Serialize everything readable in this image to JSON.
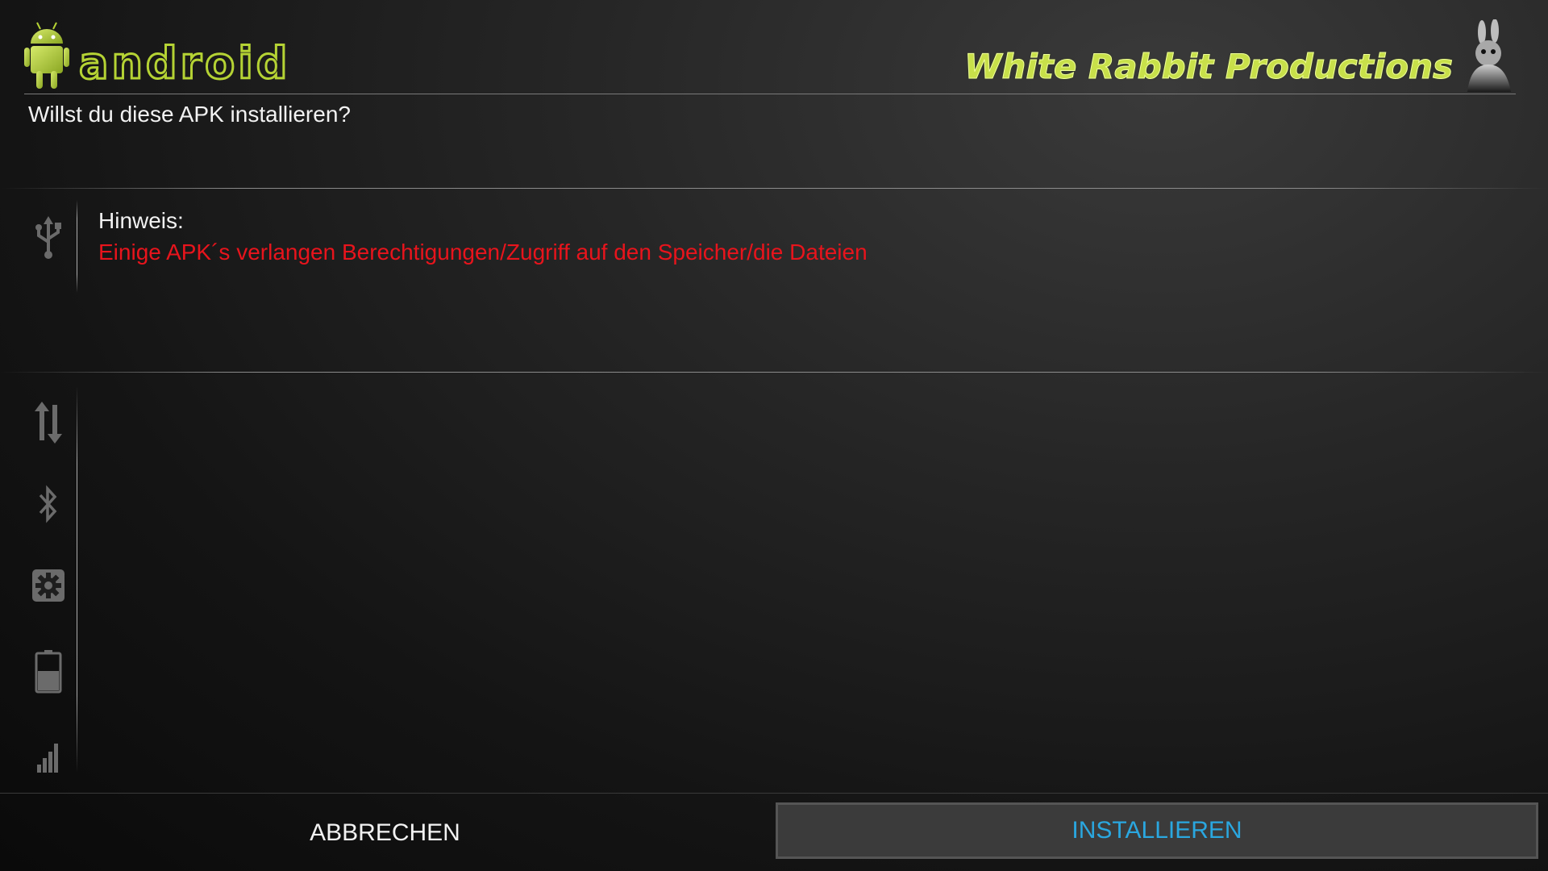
{
  "header": {
    "logo_text": "android",
    "brand_text": "White Rabbit Productions"
  },
  "dialog": {
    "question": "Willst du diese APK installieren?",
    "notice_title": "Hinweis:",
    "notice_text": "Einige APK´s verlangen Berechtigungen/Zugriff auf den Speicher/die Dateien"
  },
  "sidebar": {
    "icons": [
      "usb-icon",
      "data-transfer-icon",
      "bluetooth-icon",
      "settings-icon",
      "battery-icon",
      "signal-icon"
    ]
  },
  "buttons": {
    "cancel_label": "ABBRECHEN",
    "install_label": "INSTALLIEREN"
  },
  "colors": {
    "brand_green": "#b5d334",
    "notice_red": "#e8141c",
    "install_blue": "#2aa7e0"
  }
}
